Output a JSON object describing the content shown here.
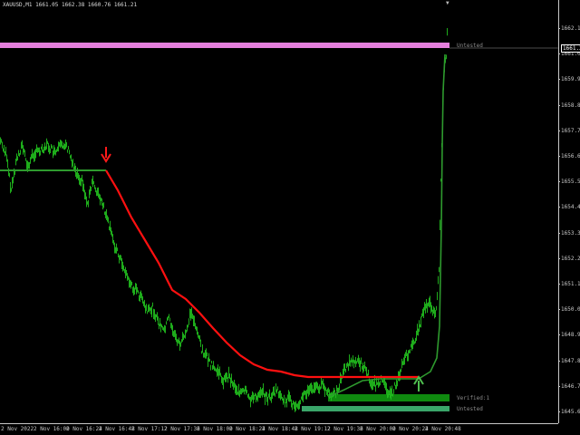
{
  "symbol_title": "XAUUSD,M1  1661.05 1662.38 1660.76 1661.21",
  "current_price": "1661.21",
  "price_axis": [
    "1662.15",
    "1661.09",
    "1659.95",
    "1658.85",
    "1657.75",
    "1656.65",
    "1655.55",
    "1654.45",
    "1653.35",
    "1652.25",
    "1651.15",
    "1650.05",
    "1648.95",
    "1647.85",
    "1646.75",
    "1645.65"
  ],
  "time_axis": [
    "2 Nov 2022",
    "2 Nov 16:00",
    "2 Nov 16:24",
    "2 Nov 16:48",
    "2 Nov 17:12",
    "2 Nov 17:36",
    "2 Nov 18:00",
    "2 Nov 18:24",
    "2 Nov 18:48",
    "2 Nov 19:12",
    "2 Nov 19:36",
    "2 Nov 20:00",
    "2 Nov 20:24",
    "2 Nov 20:48"
  ],
  "zones": {
    "upper_label": "Untested",
    "lower1_label": "Verified:1",
    "lower2_label": "Untested"
  },
  "colors": {
    "background": "#000000",
    "candles": "#22c01f",
    "ma_down": "#ff1010",
    "ma_up": "#2e9a2e",
    "resistance_zone": "#e57fdc",
    "support_zone_verified": "#0f8a0f",
    "support_zone_untested": "#3aa66a",
    "axis": "#c8c8c8"
  },
  "icons": {
    "sell_arrow": "down-arrow-icon",
    "buy_arrow": "up-arrow-icon"
  }
}
